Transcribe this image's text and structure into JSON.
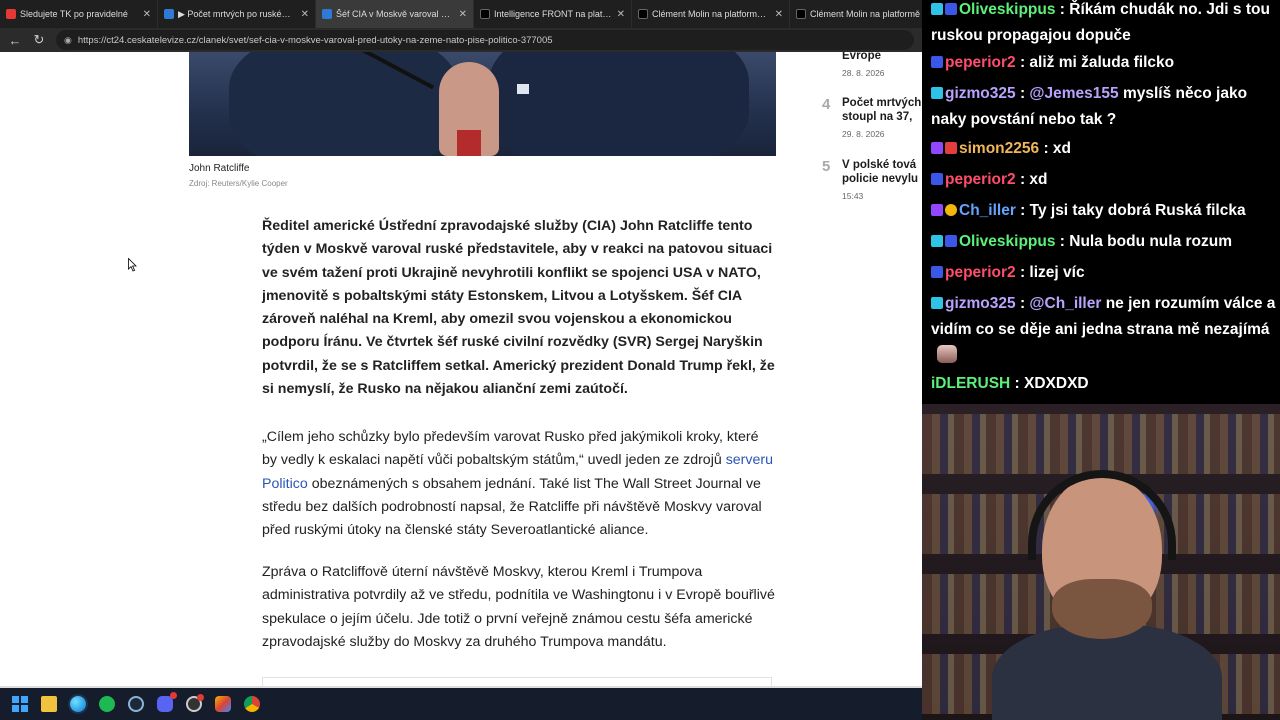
{
  "browser": {
    "tabs": [
      {
        "title": "Sledujete TK po pravidelné",
        "color": "#e53935",
        "active": false
      },
      {
        "title": "▶ Počet mrtvých po ruském útoku",
        "color": "#2e7bd6",
        "active": false
      },
      {
        "title": "Šéf CIA v Moskvě varoval před útoky",
        "color": "#2e7bd6",
        "active": true
      },
      {
        "title": "Intelligence FRONT na platformě X",
        "color": "#000000",
        "active": false
      },
      {
        "title": "Clément Molin na platformě X: „A",
        "color": "#000000",
        "active": false
      },
      {
        "title": "Clément Molin na platformě X",
        "color": "#000000",
        "active": false
      }
    ],
    "tab_close": "✕",
    "nav": {
      "back": "←",
      "reload": "↻"
    },
    "url": "https://ct24.ceskatelevize.cz/clanek/svet/sef-cia-v-moskve-varoval-pred-utoky-na-zeme-nato-pise-politico-377005"
  },
  "article": {
    "image_caption": "John Ratcliffe",
    "image_credit": "Zdroj: Reuters/Kylie Cooper",
    "lead": "Ředitel americké Ústřední zpravodajské služby (CIA) John Ratcliffe tento týden v Moskvě varoval ruské představitele, aby v reakci na patovou situaci ve svém tažení proti Ukrajině nevyhrotili konflikt se spojenci USA v NATO, jmenovitě s pobaltskými státy Estonskem, Litvou a Lotyšskem. Šéf CIA zároveň naléhal na Kreml, aby omezil svou vojenskou a ekonomickou podporu Íránu. Ve čtvrtek šéf ruské civilní rozvědky (SVR) Sergej Naryškin potvrdil, že se s Ratcliffem setkal. Americký prezident Donald Trump řekl, že si nemyslí, že Rusko na nějakou alianční zemi zaútočí.",
    "p1_before": "„Cílem jeho schůzky bylo především varovat Rusko před jakýmikoli kroky, které by vedly k eskalaci napětí vůči pobaltským státům,“ uvedl jeden ze zdrojů ",
    "p1_link": "serveru Politico",
    "p1_after": " obeznámených s obsahem jednání. Také list The Wall Street Journal ve středu bez dalších podrobností napsal, že Ratcliffe při návštěvě Moskvy varoval před ruskými útoky na členské státy Severoatlantické aliance.",
    "p2": "Zpráva o Ratcliffově úterní návštěvě Moskvy, kterou Kreml i Trumpova administrativa potvrdily až ve středu, podnítila ve Washingtonu i v Evropě bouřlivé spekulace o jejím účelu. Jde totiž o první veřejně známou cestu šéfa americké zpravodajské služby do Moskvy za druhého Trumpova mandátu."
  },
  "most_read": [
    {
      "num": "",
      "title": "Evropě",
      "date": "28. 8. 2026"
    },
    {
      "num": "4",
      "title": "Počet mrtvých",
      "title2": "stoupl na 37,",
      "date": "29. 8. 2026"
    },
    {
      "num": "5",
      "title": "V polské tová",
      "title2": "policie nevylu",
      "date": "15:43"
    }
  ],
  "chat": [
    {
      "badges": [
        "cyan",
        "blue"
      ],
      "user": "Oliveskippus",
      "color": "#5cf07a",
      "text": "Říkám chudák no. Jdi s tou ruskou propagajou dopuče"
    },
    {
      "badges": [
        "blue"
      ],
      "user": "peperior2",
      "color": "#ff4d6a",
      "text": "aliž mi žaluda filcko"
    },
    {
      "badges": [
        "cyan"
      ],
      "user": "gizmo325",
      "color": "#b9a3ff",
      "mention": "@Jemes155",
      "text": " myslíš něco jako naky povstání nebo tak ?"
    },
    {
      "badges": [
        "purple",
        "red"
      ],
      "user": "simon2256",
      "color": "#f0b65a",
      "text": "xd"
    },
    {
      "badges": [
        "blue"
      ],
      "user": "peperior2",
      "color": "#ff4d6a",
      "text": "xd"
    },
    {
      "badges": [
        "purple",
        "gold"
      ],
      "user": "Ch_iller",
      "color": "#66a3ff",
      "text": "Ty jsi taky dobrá Ruská filcka"
    },
    {
      "badges": [
        "cyan",
        "blue"
      ],
      "user": "Oliveskippus",
      "color": "#5cf07a",
      "text": "Nula bodu nula rozum"
    },
    {
      "badges": [
        "blue"
      ],
      "user": "peperior2",
      "color": "#ff4d6a",
      "text": "lizej víc"
    },
    {
      "badges": [
        "cyan"
      ],
      "user": "gizmo325",
      "color": "#b9a3ff",
      "mention": "@Ch_iller",
      "text": " ne jen rozumím válce a vidím co se děje ani jedna strana mě nezajímá"
    },
    {
      "badges": [],
      "user": "iDLERUSH",
      "color": "#5cf07a",
      "text": "XDXDXD"
    }
  ],
  "chat_separator": " : ",
  "taskbar_icons": [
    "windows-icon",
    "file-explorer-icon",
    "edge-icon",
    "spotify-icon",
    "steam-icon",
    "discord-icon",
    "obs-icon",
    "multi-app-icon",
    "chrome-icon"
  ]
}
